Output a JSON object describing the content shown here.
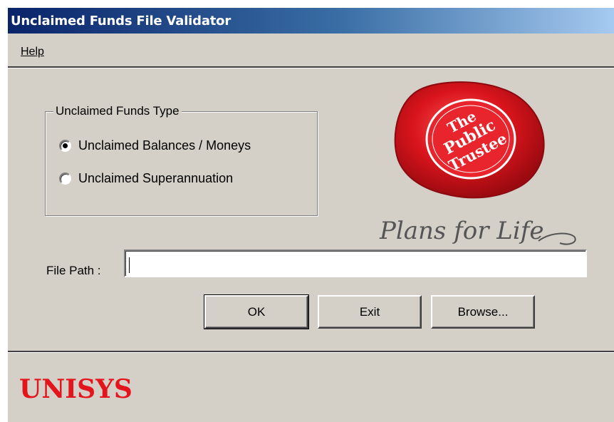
{
  "window": {
    "title": "Unclaimed Funds File Validator"
  },
  "menu": {
    "help": "Help"
  },
  "funds_type": {
    "legend": "Unclaimed Funds Type",
    "options": [
      {
        "label": "Unclaimed Balances / Moneys",
        "selected": true
      },
      {
        "label": "Unclaimed Superannuation",
        "selected": false
      }
    ]
  },
  "logo": {
    "seal_line1": "The",
    "seal_line2": "Public",
    "seal_line3": "Trustee",
    "tagline": "Plans for Life",
    "seal_color": "#d9141c"
  },
  "file_path": {
    "label": "File Path :",
    "value": ""
  },
  "buttons": {
    "ok": "OK",
    "exit": "Exit",
    "browse": "Browse..."
  },
  "footer": {
    "brand": "UNISYS",
    "brand_color": "#e4141c"
  },
  "colors": {
    "face": "#d4d0c8",
    "title_start": "#0a246a",
    "title_end": "#a6caf0"
  }
}
